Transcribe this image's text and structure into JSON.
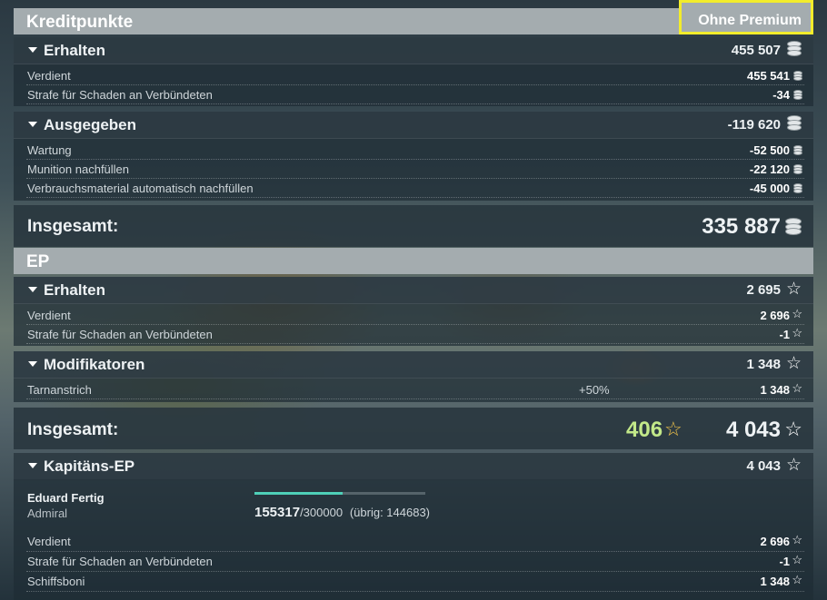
{
  "credits": {
    "title": "Kreditpunkte",
    "premium_toggle": "Ohne Premium",
    "earned": {
      "label": "Erhalten",
      "value": "455 507",
      "rows": [
        {
          "label": "Verdient",
          "value": "455 541"
        },
        {
          "label": "Strafe für Schaden an Verbündeten",
          "value": "-34"
        }
      ]
    },
    "spent": {
      "label": "Ausgegeben",
      "value": "-119 620",
      "rows": [
        {
          "label": "Wartung",
          "value": "-52 500"
        },
        {
          "label": "Munition nachfüllen",
          "value": "-22 120"
        },
        {
          "label": "Verbrauchsmaterial automatisch nachfüllen",
          "value": "-45 000"
        }
      ]
    },
    "total": {
      "label": "Insgesamt:",
      "value": "335 887"
    }
  },
  "xp": {
    "title": "EP",
    "earned": {
      "label": "Erhalten",
      "value": "2 695",
      "rows": [
        {
          "label": "Verdient",
          "value": "2 696"
        },
        {
          "label": "Strafe für Schaden an Verbündeten",
          "value": "-1"
        }
      ]
    },
    "modifiers": {
      "label": "Modifikatoren",
      "value": "1 348",
      "rows": [
        {
          "label": "Tarnanstrich",
          "percent": "+50%",
          "value": "1 348"
        }
      ]
    },
    "total": {
      "label": "Insgesamt:",
      "free_value": "406",
      "value": "4 043"
    }
  },
  "captain": {
    "label": "Kapitäns-EP",
    "value": "4 043",
    "name": "Eduard Fertig",
    "rank": "Admiral",
    "xp_current": "155317",
    "xp_max": "/300000",
    "xp_remaining": "(übrig: 144683)",
    "progress_fraction": 0.518,
    "rows": [
      {
        "label": "Verdient",
        "value": "2 696"
      },
      {
        "label": "Strafe für Schaden an Verbündeten",
        "value": "-1"
      },
      {
        "label": "Schiffsboni",
        "value": "1 348"
      }
    ]
  },
  "icons": {
    "credit": "coin-stack-icon",
    "xp": "star-outline-icon",
    "collapse": "triangle-down-icon"
  },
  "colors": {
    "section_header": "#a4acaf",
    "highlight_border": "#f2ec2c",
    "free_xp": "#c2e889",
    "progress": "#4fd0b8"
  }
}
